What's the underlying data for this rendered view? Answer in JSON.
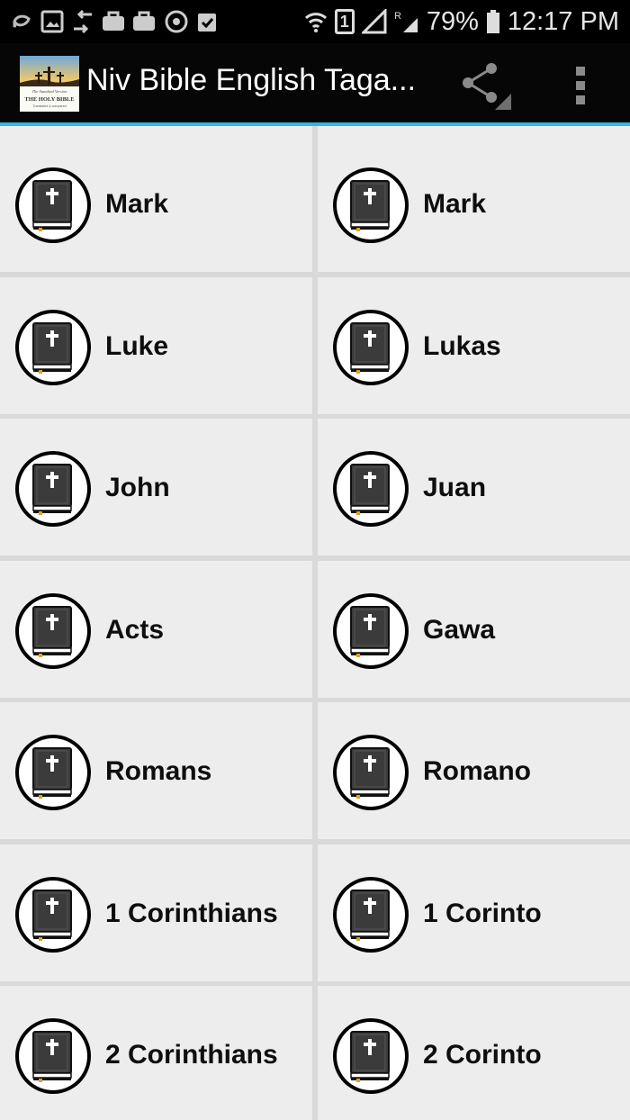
{
  "status_bar": {
    "battery": "79%",
    "time": "12:17 PM",
    "sim": "1",
    "icons": [
      "back-arrow-icon",
      "image-icon",
      "sync-icon",
      "briefcase-icon",
      "briefcase-icon",
      "target-icon",
      "clipboard-check-icon",
      "wifi-icon",
      "sim-icon",
      "signal-icon",
      "battery-icon"
    ]
  },
  "action_bar": {
    "title": "Niv Bible English Taga...",
    "logo_text_line1": "The Standard Version",
    "logo_text_line2": "THE HOLY BIBLE",
    "logo_text_line3": "Translated & compared",
    "share_icon": "share-icon",
    "menu_icon": "overflow-menu-icon",
    "accent": "#33b5e5"
  },
  "books": [
    {
      "english": "Mark",
      "tagalog": "Mark"
    },
    {
      "english": "Luke",
      "tagalog": "Lukas"
    },
    {
      "english": "John",
      "tagalog": "Juan"
    },
    {
      "english": "Acts",
      "tagalog": "Gawa"
    },
    {
      "english": "Romans",
      "tagalog": "Romano"
    },
    {
      "english": "1 Corinthians",
      "tagalog": "1 Corinto"
    },
    {
      "english": "2 Corinthians",
      "tagalog": "2 Corinto"
    }
  ],
  "book_icon": "holy-bible-book-icon"
}
